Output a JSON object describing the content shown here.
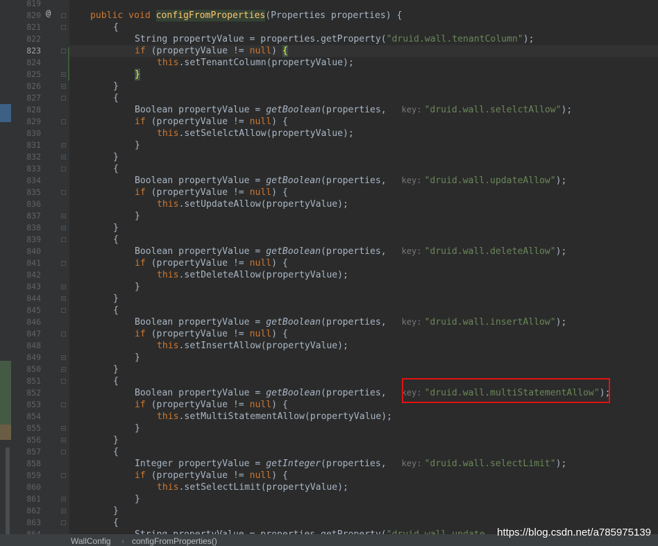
{
  "gutter": {
    "line_start": 819,
    "current_line": 823,
    "override_marker": "@"
  },
  "code_lines": [
    {
      "n": 819,
      "indent": 0,
      "tokens": []
    },
    {
      "n": 820,
      "indent": 1,
      "tokens": [
        {
          "t": "public void ",
          "k": "kw"
        },
        {
          "t": "configFromProperties",
          "k": "fn-decl"
        },
        {
          "t": "(Properties properties) {",
          "k": "plain"
        }
      ]
    },
    {
      "n": 821,
      "indent": 2,
      "tokens": [
        {
          "t": "{",
          "k": "plain"
        }
      ]
    },
    {
      "n": 822,
      "indent": 3,
      "tokens": [
        {
          "t": "String propertyValue = properties.getProperty(",
          "k": "plain"
        },
        {
          "t": "\"druid.wall.tenantColumn\"",
          "k": "str"
        },
        {
          "t": ");",
          "k": "plain"
        }
      ]
    },
    {
      "n": 823,
      "indent": 3,
      "tokens": [
        {
          "t": "if ",
          "k": "kw"
        },
        {
          "t": "(propertyValue != ",
          "k": "plain"
        },
        {
          "t": "null",
          "k": "kw"
        },
        {
          "t": ") ",
          "k": "plain"
        },
        {
          "t": "{",
          "k": "brace"
        }
      ]
    },
    {
      "n": 824,
      "indent": 4,
      "tokens": [
        {
          "t": "this",
          "k": "kw"
        },
        {
          "t": ".setTenantColumn(propertyValue);",
          "k": "plain"
        }
      ]
    },
    {
      "n": 825,
      "indent": 3,
      "tokens": [
        {
          "t": "}",
          "k": "brace"
        }
      ]
    },
    {
      "n": 826,
      "indent": 2,
      "tokens": [
        {
          "t": "}",
          "k": "plain"
        }
      ]
    },
    {
      "n": 827,
      "indent": 2,
      "tokens": [
        {
          "t": "{",
          "k": "plain"
        }
      ]
    },
    {
      "n": 828,
      "indent": 3,
      "tokens": [
        {
          "t": "Boolean propertyValue = ",
          "k": "plain"
        },
        {
          "t": "getBoolean",
          "k": "it"
        },
        {
          "t": "(properties, ",
          "k": "plain"
        },
        {
          "t": "key:",
          "k": "hint"
        },
        {
          "t": "\"druid.wall.selelctAllow\"",
          "k": "str"
        },
        {
          "t": ");",
          "k": "plain"
        }
      ]
    },
    {
      "n": 829,
      "indent": 3,
      "tokens": [
        {
          "t": "if ",
          "k": "kw"
        },
        {
          "t": "(propertyValue != ",
          "k": "plain"
        },
        {
          "t": "null",
          "k": "kw"
        },
        {
          "t": ") {",
          "k": "plain"
        }
      ]
    },
    {
      "n": 830,
      "indent": 4,
      "tokens": [
        {
          "t": "this",
          "k": "kw"
        },
        {
          "t": ".setSelelctAllow(propertyValue);",
          "k": "plain"
        }
      ]
    },
    {
      "n": 831,
      "indent": 3,
      "tokens": [
        {
          "t": "}",
          "k": "plain"
        }
      ]
    },
    {
      "n": 832,
      "indent": 2,
      "tokens": [
        {
          "t": "}",
          "k": "plain"
        }
      ]
    },
    {
      "n": 833,
      "indent": 2,
      "tokens": [
        {
          "t": "{",
          "k": "plain"
        }
      ]
    },
    {
      "n": 834,
      "indent": 3,
      "tokens": [
        {
          "t": "Boolean propertyValue = ",
          "k": "plain"
        },
        {
          "t": "getBoolean",
          "k": "it"
        },
        {
          "t": "(properties, ",
          "k": "plain"
        },
        {
          "t": "key:",
          "k": "hint"
        },
        {
          "t": "\"druid.wall.updateAllow\"",
          "k": "str"
        },
        {
          "t": ");",
          "k": "plain"
        }
      ]
    },
    {
      "n": 835,
      "indent": 3,
      "tokens": [
        {
          "t": "if ",
          "k": "kw"
        },
        {
          "t": "(propertyValue != ",
          "k": "plain"
        },
        {
          "t": "null",
          "k": "kw"
        },
        {
          "t": ") {",
          "k": "plain"
        }
      ]
    },
    {
      "n": 836,
      "indent": 4,
      "tokens": [
        {
          "t": "this",
          "k": "kw"
        },
        {
          "t": ".setUpdateAllow(propertyValue);",
          "k": "plain"
        }
      ]
    },
    {
      "n": 837,
      "indent": 3,
      "tokens": [
        {
          "t": "}",
          "k": "plain"
        }
      ]
    },
    {
      "n": 838,
      "indent": 2,
      "tokens": [
        {
          "t": "}",
          "k": "plain"
        }
      ]
    },
    {
      "n": 839,
      "indent": 2,
      "tokens": [
        {
          "t": "{",
          "k": "plain"
        }
      ]
    },
    {
      "n": 840,
      "indent": 3,
      "tokens": [
        {
          "t": "Boolean propertyValue = ",
          "k": "plain"
        },
        {
          "t": "getBoolean",
          "k": "it"
        },
        {
          "t": "(properties, ",
          "k": "plain"
        },
        {
          "t": "key:",
          "k": "hint"
        },
        {
          "t": "\"druid.wall.deleteAllow\"",
          "k": "str"
        },
        {
          "t": ");",
          "k": "plain"
        }
      ]
    },
    {
      "n": 841,
      "indent": 3,
      "tokens": [
        {
          "t": "if ",
          "k": "kw"
        },
        {
          "t": "(propertyValue != ",
          "k": "plain"
        },
        {
          "t": "null",
          "k": "kw"
        },
        {
          "t": ") {",
          "k": "plain"
        }
      ]
    },
    {
      "n": 842,
      "indent": 4,
      "tokens": [
        {
          "t": "this",
          "k": "kw"
        },
        {
          "t": ".setDeleteAllow(propertyValue);",
          "k": "plain"
        }
      ]
    },
    {
      "n": 843,
      "indent": 3,
      "tokens": [
        {
          "t": "}",
          "k": "plain"
        }
      ]
    },
    {
      "n": 844,
      "indent": 2,
      "tokens": [
        {
          "t": "}",
          "k": "plain"
        }
      ]
    },
    {
      "n": 845,
      "indent": 2,
      "tokens": [
        {
          "t": "{",
          "k": "plain"
        }
      ]
    },
    {
      "n": 846,
      "indent": 3,
      "tokens": [
        {
          "t": "Boolean propertyValue = ",
          "k": "plain"
        },
        {
          "t": "getBoolean",
          "k": "it"
        },
        {
          "t": "(properties, ",
          "k": "plain"
        },
        {
          "t": "key:",
          "k": "hint"
        },
        {
          "t": "\"druid.wall.insertAllow\"",
          "k": "str"
        },
        {
          "t": ");",
          "k": "plain"
        }
      ]
    },
    {
      "n": 847,
      "indent": 3,
      "tokens": [
        {
          "t": "if ",
          "k": "kw"
        },
        {
          "t": "(propertyValue != ",
          "k": "plain"
        },
        {
          "t": "null",
          "k": "kw"
        },
        {
          "t": ") {",
          "k": "plain"
        }
      ]
    },
    {
      "n": 848,
      "indent": 4,
      "tokens": [
        {
          "t": "this",
          "k": "kw"
        },
        {
          "t": ".setInsertAllow(propertyValue);",
          "k": "plain"
        }
      ]
    },
    {
      "n": 849,
      "indent": 3,
      "tokens": [
        {
          "t": "}",
          "k": "plain"
        }
      ]
    },
    {
      "n": 850,
      "indent": 2,
      "tokens": [
        {
          "t": "}",
          "k": "plain"
        }
      ]
    },
    {
      "n": 851,
      "indent": 2,
      "tokens": [
        {
          "t": "{",
          "k": "plain"
        }
      ]
    },
    {
      "n": 852,
      "indent": 3,
      "tokens": [
        {
          "t": "Boolean propertyValue = ",
          "k": "plain"
        },
        {
          "t": "getBoolean",
          "k": "it"
        },
        {
          "t": "(properties, ",
          "k": "plain"
        },
        {
          "t": "key:",
          "k": "hint"
        },
        {
          "t": "\"druid.wall.multiStatementAllow\"",
          "k": "str"
        },
        {
          "t": ");",
          "k": "plain"
        }
      ]
    },
    {
      "n": 853,
      "indent": 3,
      "tokens": [
        {
          "t": "if ",
          "k": "kw"
        },
        {
          "t": "(propertyValue != ",
          "k": "plain"
        },
        {
          "t": "null",
          "k": "kw"
        },
        {
          "t": ") {",
          "k": "plain"
        }
      ]
    },
    {
      "n": 854,
      "indent": 4,
      "tokens": [
        {
          "t": "this",
          "k": "kw"
        },
        {
          "t": ".setMultiStatementAllow(propertyValue);",
          "k": "plain"
        }
      ]
    },
    {
      "n": 855,
      "indent": 3,
      "tokens": [
        {
          "t": "}",
          "k": "plain"
        }
      ]
    },
    {
      "n": 856,
      "indent": 2,
      "tokens": [
        {
          "t": "}",
          "k": "plain"
        }
      ]
    },
    {
      "n": 857,
      "indent": 2,
      "tokens": [
        {
          "t": "{",
          "k": "plain"
        }
      ]
    },
    {
      "n": 858,
      "indent": 3,
      "tokens": [
        {
          "t": "Integer propertyValue = ",
          "k": "plain"
        },
        {
          "t": "getInteger",
          "k": "it"
        },
        {
          "t": "(properties, ",
          "k": "plain"
        },
        {
          "t": "key:",
          "k": "hint"
        },
        {
          "t": "\"druid.wall.selectLimit\"",
          "k": "str"
        },
        {
          "t": ");",
          "k": "plain"
        }
      ]
    },
    {
      "n": 859,
      "indent": 3,
      "tokens": [
        {
          "t": "if ",
          "k": "kw"
        },
        {
          "t": "(propertyValue != ",
          "k": "plain"
        },
        {
          "t": "null",
          "k": "kw"
        },
        {
          "t": ") {",
          "k": "plain"
        }
      ]
    },
    {
      "n": 860,
      "indent": 4,
      "tokens": [
        {
          "t": "this",
          "k": "kw"
        },
        {
          "t": ".setSelectLimit(propertyValue);",
          "k": "plain"
        }
      ]
    },
    {
      "n": 861,
      "indent": 3,
      "tokens": [
        {
          "t": "}",
          "k": "plain"
        }
      ]
    },
    {
      "n": 862,
      "indent": 2,
      "tokens": [
        {
          "t": "}",
          "k": "plain"
        }
      ]
    },
    {
      "n": 863,
      "indent": 2,
      "tokens": [
        {
          "t": "{",
          "k": "plain"
        }
      ]
    },
    {
      "n": 864,
      "indent": 3,
      "tokens": [
        {
          "t": "String propertyValue = properties.getProperty(",
          "k": "plain"
        },
        {
          "t": "\"druid.wall.update",
          "k": "str"
        }
      ]
    }
  ],
  "breadcrumb": {
    "class_name": "WallConfig",
    "separator": "›",
    "method_name": "configFromProperties()"
  },
  "watermark": "https://blog.csdn.net/a785975139",
  "colors": {
    "background": "#2b2b2b",
    "keyword": "#cc7832",
    "string": "#6a8759",
    "plain": "#a9b7c6",
    "highlight_box": "#e31212"
  }
}
